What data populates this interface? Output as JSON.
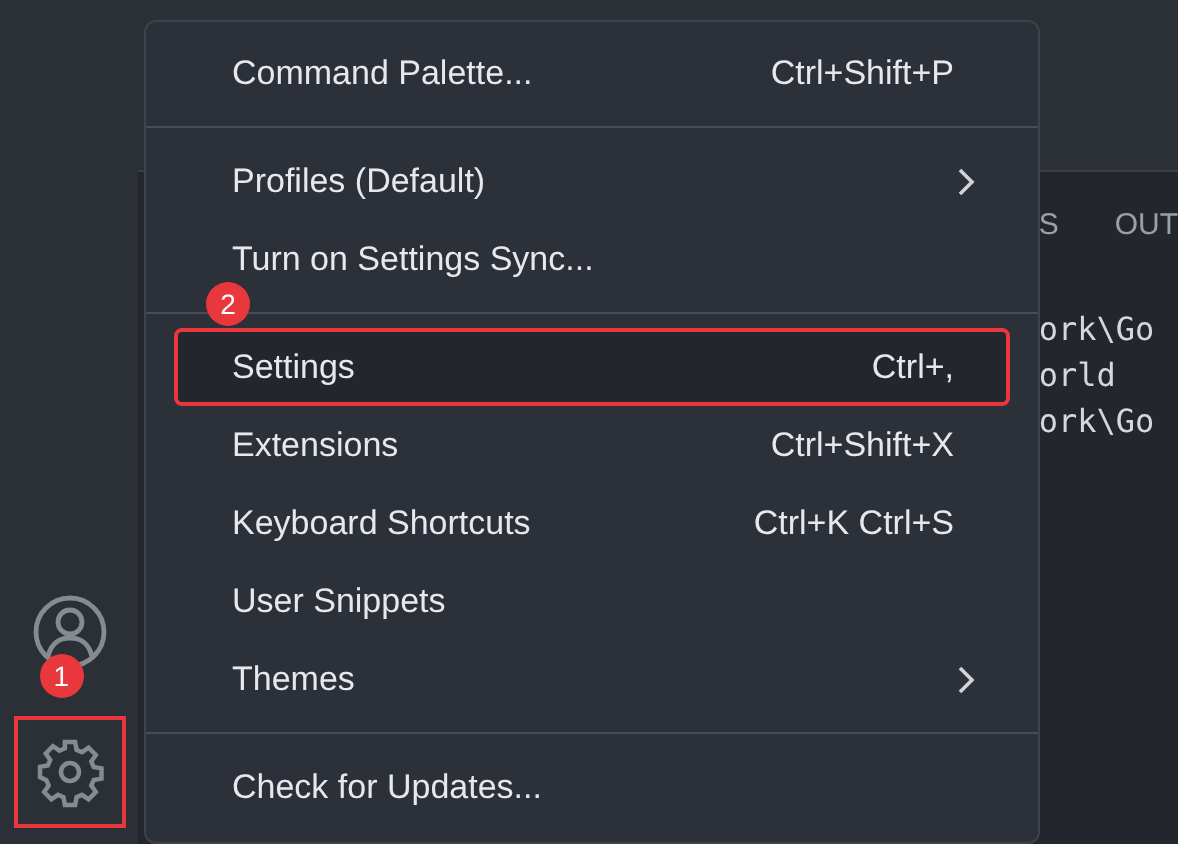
{
  "activity_bar": {
    "items": [
      {
        "kind": "account"
      },
      {
        "kind": "manage",
        "callout": "1"
      }
    ]
  },
  "panel": {
    "tabs": [
      {
        "label": "S"
      },
      {
        "label": "OUT"
      }
    ],
    "terminal_lines": [
      "ork\\Go",
      "orld",
      "ork\\Go"
    ]
  },
  "menu": {
    "groups": [
      [
        {
          "label": "Command Palette...",
          "shortcut": "Ctrl+Shift+P",
          "selected": false
        }
      ],
      [
        {
          "label": "Profiles (Default)",
          "submenu": true,
          "selected": false
        },
        {
          "label": "Turn on Settings Sync...",
          "selected": false
        }
      ],
      [
        {
          "label": "Settings",
          "shortcut": "Ctrl+,",
          "selected": true,
          "callout": "2"
        },
        {
          "label": "Extensions",
          "shortcut": "Ctrl+Shift+X",
          "selected": false
        },
        {
          "label": "Keyboard Shortcuts",
          "shortcut": "Ctrl+K Ctrl+S",
          "selected": false
        },
        {
          "label": "User Snippets",
          "selected": false
        },
        {
          "label": "Themes",
          "submenu": true,
          "selected": false
        }
      ],
      [
        {
          "label": "Check for Updates...",
          "selected": false
        }
      ]
    ]
  }
}
